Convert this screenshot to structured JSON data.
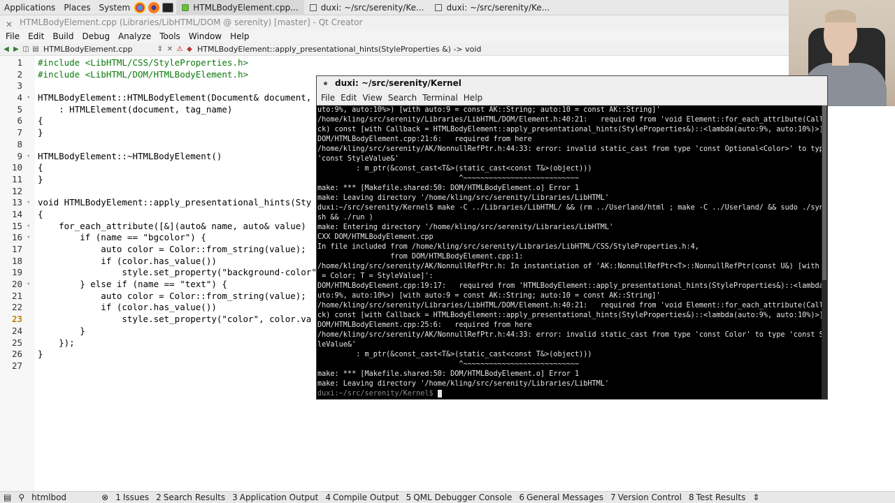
{
  "panel": {
    "menus": [
      "Applications",
      "Places",
      "System"
    ],
    "tasks": [
      {
        "label": "HTMLBodyElement.cpp..."
      },
      {
        "label": "duxi: ~/src/serenity/Ke..."
      },
      {
        "label": "duxi: ~/src/serenity/Ke..."
      }
    ]
  },
  "window": {
    "title": "HTMLBodyElement.cpp (Libraries/LibHTML/DOM @ serenity) [master] - Qt Creator"
  },
  "menubar": [
    "File",
    "Edit",
    "Build",
    "Debug",
    "Analyze",
    "Tools",
    "Window",
    "Help"
  ],
  "editor": {
    "filename": "HTMLBodyElement.cpp",
    "symbol": "HTMLBodyElement::apply_presentational_hints(StyleProperties &) -> void",
    "line_numbers": [
      "1",
      "2",
      "3",
      "4",
      "5",
      "6",
      "7",
      "8",
      "9",
      "10",
      "11",
      "12",
      "13",
      "14",
      "15",
      "16",
      "17",
      "18",
      "19",
      "20",
      "21",
      "22",
      "23",
      "24",
      "25",
      "26",
      "27"
    ],
    "current_line": "23",
    "lines": [
      "#include <LibHTML/CSS/StyleProperties.h>",
      "#include <LibHTML/DOM/HTMLBodyElement.h>",
      "",
      "HTMLBodyElement::HTMLBodyElement(Document& document,",
      "    : HTMLElement(document, tag_name)",
      "{",
      "}",
      "",
      "HTMLBodyElement::~HTMLBodyElement()",
      "{",
      "}",
      "",
      "void HTMLBodyElement::apply_presentational_hints(Sty",
      "{",
      "    for_each_attribute([&](auto& name, auto& value)",
      "        if (name == \"bgcolor\") {",
      "            auto color = Color::from_string(value);",
      "            if (color.has_value())",
      "                style.set_property(\"background-color\"",
      "        } else if (name == \"text\") {",
      "            auto color = Color::from_string(value);",
      "            if (color.has_value())",
      "                style.set_property(\"color\", color.va",
      "        }",
      "    });",
      "}",
      ""
    ]
  },
  "terminal": {
    "title": "duxi: ~/src/serenity/Kernel",
    "menu": [
      "File",
      "Edit",
      "View",
      "Search",
      "Terminal",
      "Help"
    ],
    "lines": [
      "uto:9%, auto:10%>) [with auto:9 = const AK::String; auto:10 = const AK::String]'",
      "/home/kling/src/serenity/Libraries/LibHTML/DOM/Element.h:40:21:   required from 'void Element::for_each_attribute(Callba",
      "ck) const [with Callback = HTMLBodyElement::apply_presentational_hints(StyleProperties&)::<lambda(auto:9%, auto:10%)>]'",
      "DOM/HTMLBodyElement.cpp:21:6:   required from here",
      "/home/kling/src/serenity/AK/NonnullRefPtr.h:44:33: error: invalid static_cast from type 'const Optional<Color>' to type",
      "'const StyleValue&'",
      "         : m_ptr(&const_cast<T&>(static_cast<const T&>(object)))",
      "                                 ^~~~~~~~~~~~~~~~~~~~~~~~~~~~",
      "make: *** [Makefile.shared:50: DOM/HTMLBodyElement.o] Error 1",
      "make: Leaving directory '/home/kling/src/serenity/Libraries/LibHTML'",
      "duxi:~/src/serenity/Kernel$ make -C ../Libraries/LibHTML/ && (rm ../Userland/html ; make -C ../Userland/ && sudo ./sync.",
      "sh && ./run )",
      "make: Entering directory '/home/kling/src/serenity/Libraries/LibHTML'",
      "CXX DOM/HTMLBodyElement.cpp",
      "In file included from /home/kling/src/serenity/Libraries/LibHTML/CSS/StyleProperties.h:4,",
      "                 from DOM/HTMLBodyElement.cpp:1:",
      "/home/kling/src/serenity/AK/NonnullRefPtr.h: In instantiation of 'AK::NonnullRefPtr<T>::NonnullRefPtr(const U&) [with U",
      " = Color; T = StyleValue]':",
      "DOM/HTMLBodyElement.cpp:19:17:   required from 'HTMLBodyElement::apply_presentational_hints(StyleProperties&)::<lambda(a",
      "uto:9%, auto:10%>) [with auto:9 = const AK::String; auto:10 = const AK::String]'",
      "/home/kling/src/serenity/Libraries/LibHTML/DOM/Element.h:40:21:   required from 'void Element::for_each_attribute(Callba",
      "ck) const [with Callback = HTMLBodyElement::apply_presentational_hints(StyleProperties&)::<lambda(auto:9%, auto:10%)>]'",
      "DOM/HTMLBodyElement.cpp:25:6:   required from here",
      "/home/kling/src/serenity/AK/NonnullRefPtr.h:44:33: error: invalid static_cast from type 'const Color' to type 'const Sty",
      "leValue&'",
      "         : m_ptr(&const_cast<T&>(static_cast<const T&>(object)))",
      "                                 ^~~~~~~~~~~~~~~~~~~~~~~~~~~~",
      "make: *** [Makefile.shared:50: DOM/HTMLBodyElement.o] Error 1",
      "make: Leaving directory '/home/kling/src/serenity/Libraries/LibHTML'"
    ],
    "prompt": "duxi:~/src/serenity/Kernel$"
  },
  "statusbar": {
    "locator": "htmlbod",
    "tabs": [
      {
        "num": "1",
        "label": "Issues"
      },
      {
        "num": "2",
        "label": "Search Results"
      },
      {
        "num": "3",
        "label": "Application Output"
      },
      {
        "num": "4",
        "label": "Compile Output"
      },
      {
        "num": "5",
        "label": "QML Debugger Console"
      },
      {
        "num": "6",
        "label": "General Messages"
      },
      {
        "num": "7",
        "label": "Version Control"
      },
      {
        "num": "8",
        "label": "Test Results"
      }
    ]
  }
}
